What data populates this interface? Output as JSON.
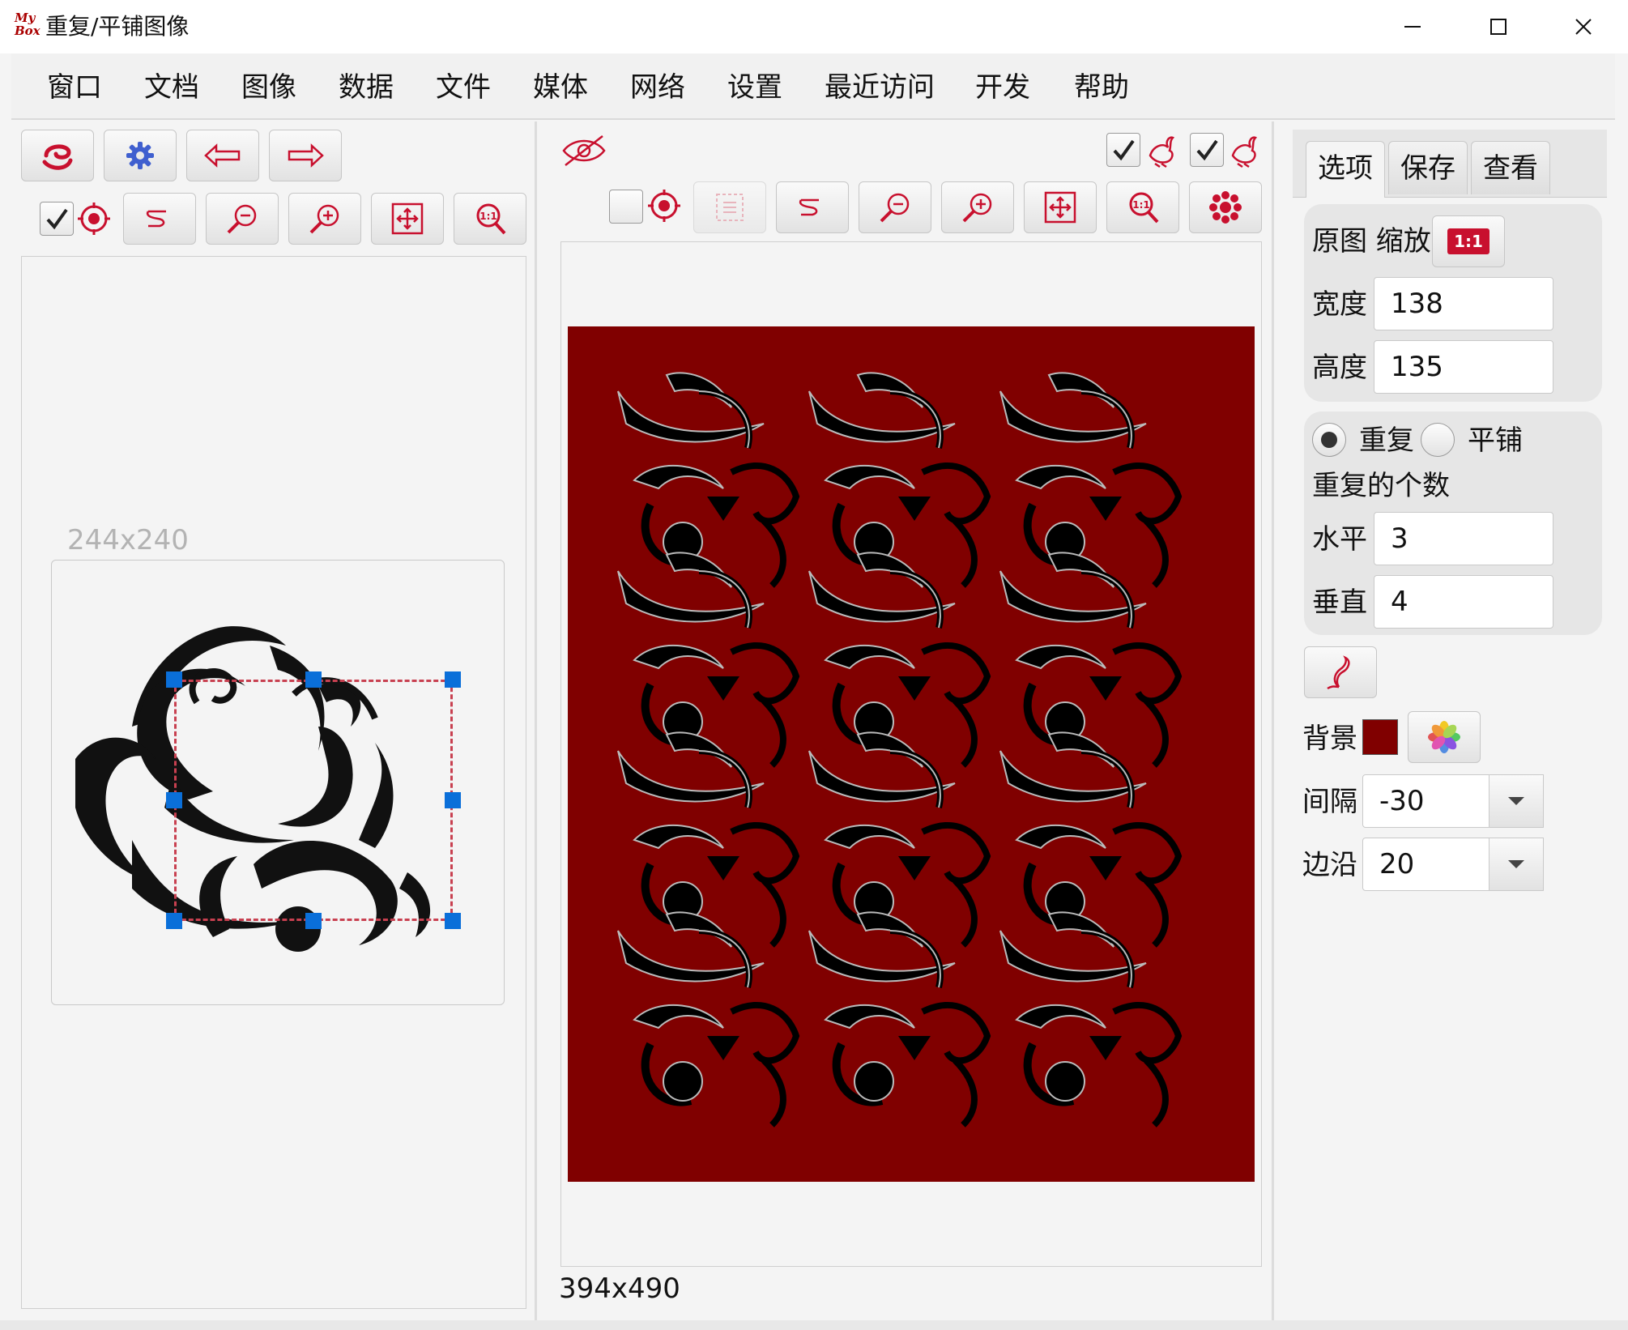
{
  "window": {
    "title": "重复/平铺图像",
    "logo_text": "My Box"
  },
  "menu": [
    "窗口",
    "文档",
    "图像",
    "数据",
    "文件",
    "媒体",
    "网络",
    "设置",
    "最近访问",
    "开发",
    "帮助"
  ],
  "source": {
    "size_label": "244x240",
    "center_checked": true
  },
  "result": {
    "size_label": "394x490",
    "center_checked": false,
    "option1_checked": true,
    "option2_checked": true,
    "background": "#800000"
  },
  "tabs": [
    "选项",
    "保存",
    "查看"
  ],
  "options": {
    "original_scale_label": "原图 缩放",
    "ratio_badge": "1:1",
    "width_label": "宽度",
    "width_value": "138",
    "height_label": "高度",
    "height_value": "135",
    "mode_repeat": "重复",
    "mode_tile": "平铺",
    "mode_selected": "重复",
    "repeat_count_label": "重复的个数",
    "horizontal_label": "水平",
    "horizontal_value": "3",
    "vertical_label": "垂直",
    "vertical_value": "4",
    "background_label": "背景",
    "background_color": "#800000",
    "interval_label": "间隔",
    "interval_value": "-30",
    "margin_label": "边沿",
    "margin_value": "20"
  },
  "colors": {
    "accent": "#c8102e",
    "handle": "#0a6fd9",
    "swatch": "#800000"
  }
}
